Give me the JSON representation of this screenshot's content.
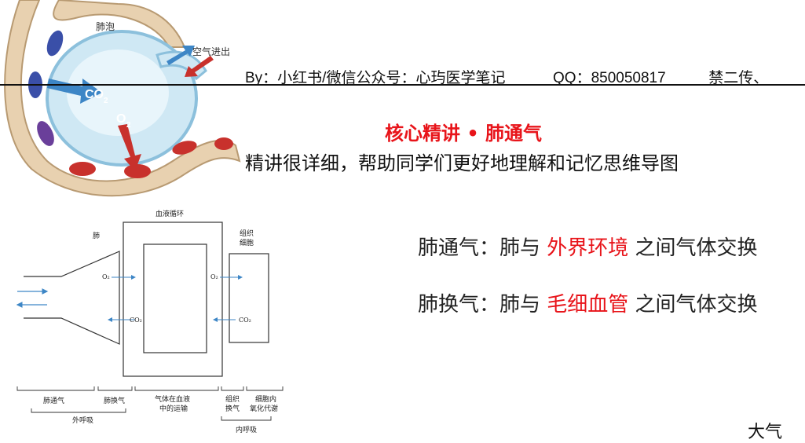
{
  "illustration": {
    "label_alveolus": "肺泡",
    "label_air": "空气进出",
    "label_co2": "CO",
    "label_co2_sub": "2",
    "label_o2": "O",
    "label_o2_sub": "2"
  },
  "header": {
    "by": "By：小红书/微信公众号：心玙医学笔记",
    "qq": "QQ：850050817",
    "ban": "禁二传、"
  },
  "title": "核心精讲 • 肺通气",
  "subtitle": "精讲很详细，帮助同学们更好地理解和记忆思维导图",
  "definitions": [
    {
      "pre": "肺通气：肺与 ",
      "highlight": "外界环境",
      "post": " 之间气体交换"
    },
    {
      "pre": "肺换气：肺与 ",
      "highlight": "毛细血管",
      "post": " 之间气体交换"
    }
  ],
  "diagram": {
    "lung": "肺",
    "circulation": "血液循环",
    "tissue_line1": "组织",
    "tissue_line2": "细胞",
    "o2": "O₂",
    "co2": "CO₂",
    "stages": {
      "ventilation": "肺通气",
      "exchange": "肺换气",
      "transport_line1": "气体在血液",
      "transport_line2": "中的运输",
      "tissue_exchange_line1": "组织",
      "tissue_exchange_line2": "换气",
      "cell_line1": "细胞内",
      "cell_line2": "氧化代谢",
      "external": "外呼吸",
      "internal": "内呼吸"
    }
  },
  "corner_text": "大气",
  "colors": {
    "accent_red": "#e8141a",
    "arrow_blue": "#3d86c6",
    "alveolus_fill": "#cfe8f4",
    "vessel_fill": "#e9d3b4",
    "rbc_red": "#c8312c",
    "rbc_blue": "#3a4fa8"
  }
}
